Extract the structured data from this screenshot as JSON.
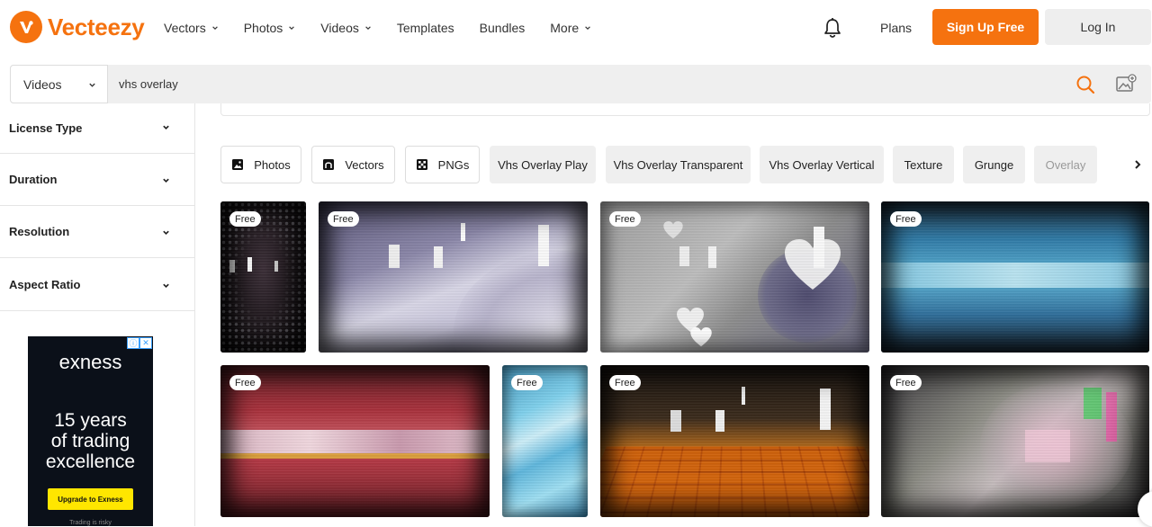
{
  "header": {
    "logo_text": "Vecteezy",
    "nav": [
      "Vectors",
      "Photos",
      "Videos",
      "Templates",
      "Bundles",
      "More"
    ],
    "nav_has_dropdown": [
      true,
      true,
      true,
      false,
      false,
      true
    ],
    "plans_label": "Plans",
    "signup_label": "Sign Up Free",
    "login_label": "Log In",
    "accent_color": "#f5720f"
  },
  "search": {
    "type_selected": "Videos",
    "query": "vhs overlay"
  },
  "sidebar": {
    "filters": [
      "License Type",
      "Duration",
      "Resolution",
      "Aspect Ratio"
    ]
  },
  "ad": {
    "brand": "exness",
    "headline_lines": [
      "15 years",
      "of trading",
      "excellence"
    ],
    "button_label": "Upgrade to Exness",
    "footer_text": "Trading is risky"
  },
  "chips": [
    {
      "label": "Photos",
      "icon": "photo-icon",
      "style": "outline"
    },
    {
      "label": "Vectors",
      "icon": "vector-icon",
      "style": "outline"
    },
    {
      "label": "PNGs",
      "icon": "png-checker-icon",
      "style": "outline"
    },
    {
      "label": "Vhs Overlay Play",
      "style": "fill"
    },
    {
      "label": "Vhs Overlay Transparent",
      "style": "fill"
    },
    {
      "label": "Vhs Overlay Vertical",
      "style": "fill"
    },
    {
      "label": "Texture",
      "style": "fill"
    },
    {
      "label": "Grunge",
      "style": "fill"
    },
    {
      "label": "Overlay",
      "style": "fill"
    }
  ],
  "results": {
    "badge_label": "Free",
    "items": [
      {
        "badge": "Free",
        "tone": "dark-dots"
      },
      {
        "badge": "Free",
        "tone": "purple-static"
      },
      {
        "badge": "Free",
        "tone": "gray-hearts"
      },
      {
        "badge": "Free",
        "tone": "blue-glitch"
      },
      {
        "badge": "Free",
        "tone": "red-noise"
      },
      {
        "badge": "Free",
        "tone": "cyan-water"
      },
      {
        "badge": "Free",
        "tone": "orange-floor"
      },
      {
        "badge": "Free",
        "tone": "rgb-glitch"
      }
    ]
  }
}
